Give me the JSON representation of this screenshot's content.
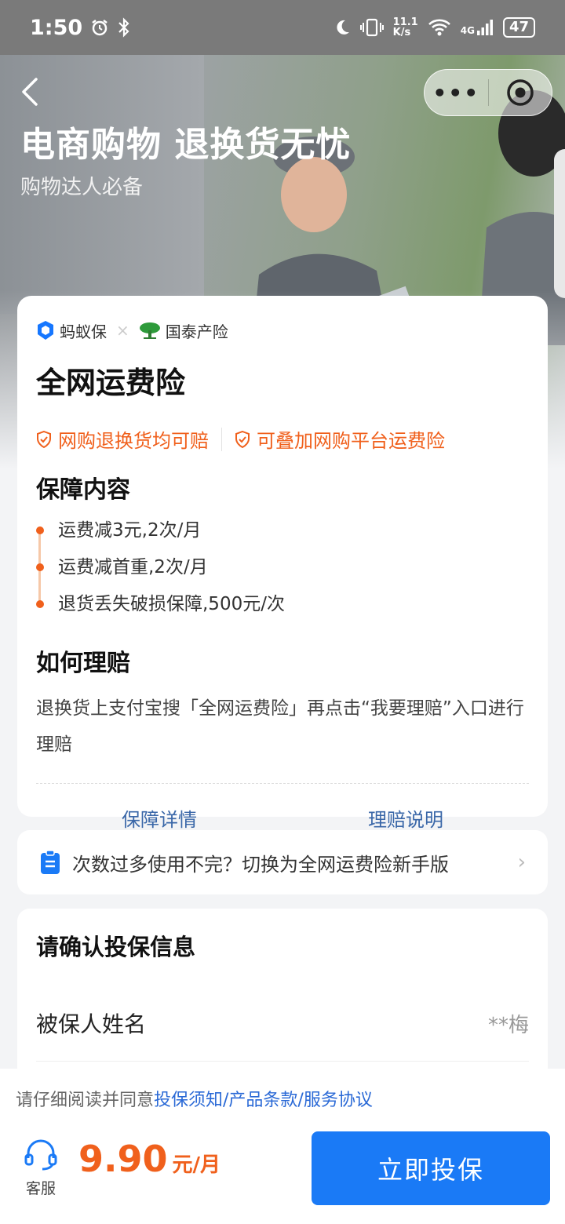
{
  "status_bar": {
    "time": "1:50",
    "net_speed_value": "11.1",
    "net_speed_unit": "K/s",
    "network": "4G",
    "battery": "47"
  },
  "hero": {
    "title": "电商购物 退换货无忧",
    "subtitle": "购物达人必备"
  },
  "capsule": {
    "more_label": "•••"
  },
  "card": {
    "brand_left": "蚂蚁保",
    "brand_sep": "×",
    "brand_right": "国泰产险",
    "product_title": "全网运费险",
    "tags": [
      "网购退换货均可赔",
      "可叠加网购平台运费险"
    ],
    "coverage_title": "保障内容",
    "coverage_items": [
      "运费减3元,2次/月",
      "运费减首重,2次/月",
      "退货丢失破损保障,500元/次"
    ],
    "claim_title": "如何理赔",
    "claim_text": "退换货上支付宝搜「全网运费险」再点击“我要理赔”入口进行理赔",
    "links": [
      "保障详情",
      "理赔说明"
    ]
  },
  "switch_banner": {
    "text": "次数过多使用不完？切换为全网运费险新手版",
    "chevron": "›"
  },
  "confirm": {
    "title": "请确认投保信息",
    "insured_label": "被保人姓名",
    "insured_value": "**梅"
  },
  "bottom": {
    "agree_prefix": "请仔细阅读并同意",
    "agree_links": "投保须知/产品条款/服务协议",
    "service_label": "客服",
    "price": "9.90",
    "price_unit": "元/月",
    "buy_label": "立即投保"
  },
  "colors": {
    "accent_orange": "#f0601c",
    "primary_blue": "#1a7af6",
    "link_blue": "#2a69d6"
  }
}
